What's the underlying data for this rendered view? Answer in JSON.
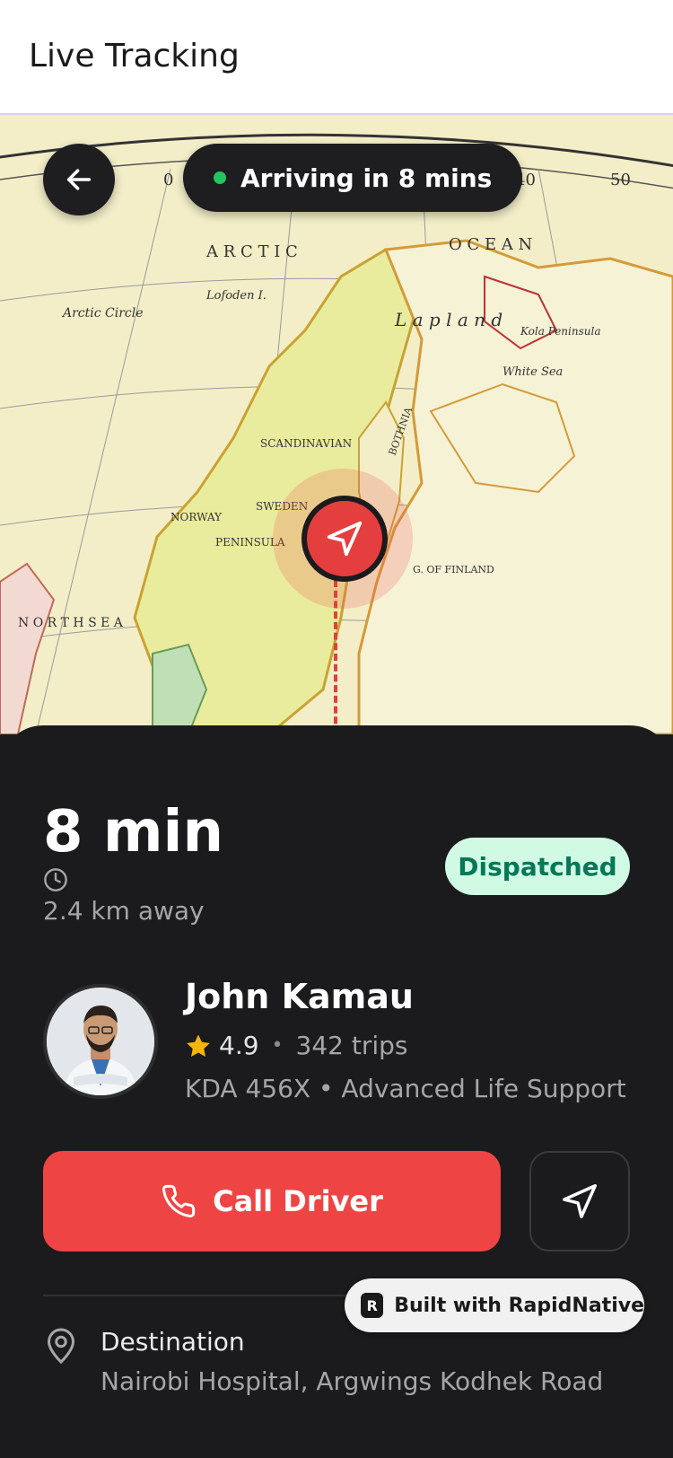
{
  "header": {
    "title": "Live Tracking"
  },
  "map": {
    "eta_pill": "Arriving in 8 mins",
    "labels": {
      "arctic": "A R C T I C",
      "ocean": "O C E A N",
      "lapland": "L a p l a n d",
      "sweden": "SWEDEN",
      "norway": "NORWAY",
      "peninsula": "PENINSULA",
      "scandinavian": "SCANDINAVIAN",
      "bothnia": "BOTHNIA",
      "north_sea": "N O R T H   S E A",
      "white_sea": "White Sea",
      "kola": "Kola Peninsula",
      "finland": "G. OF FINLAND",
      "arctic_circle": "Arctic  Circle",
      "lofoden": "Lofoden I."
    },
    "ticks": [
      "0",
      "40",
      "50"
    ]
  },
  "trip": {
    "eta": "8 min",
    "distance": "2.4 km away",
    "status": "Dispatched"
  },
  "driver": {
    "name": "John Kamau",
    "rating": "4.9",
    "separator": "•",
    "trips": "342 trips",
    "vehicle": "KDA 456X • Advanced Life Support"
  },
  "actions": {
    "call_label": "Call Driver"
  },
  "destination": {
    "label": "Destination",
    "value": "Nairobi Hospital, Argwings Kodhek Road"
  },
  "branding": {
    "built_with": "Built with RapidNative",
    "logo_letter": "R"
  },
  "colors": {
    "accent": "#ef4444",
    "status_bg": "#d1fae5",
    "status_text": "#047857",
    "online_dot": "#22c55e",
    "sheet_bg": "#1b1b1d"
  },
  "icons": [
    "back-arrow-icon",
    "navigation-arrow-icon",
    "clock-icon",
    "star-icon",
    "phone-icon",
    "map-pin-icon",
    "rapidnative-logo-icon"
  ]
}
